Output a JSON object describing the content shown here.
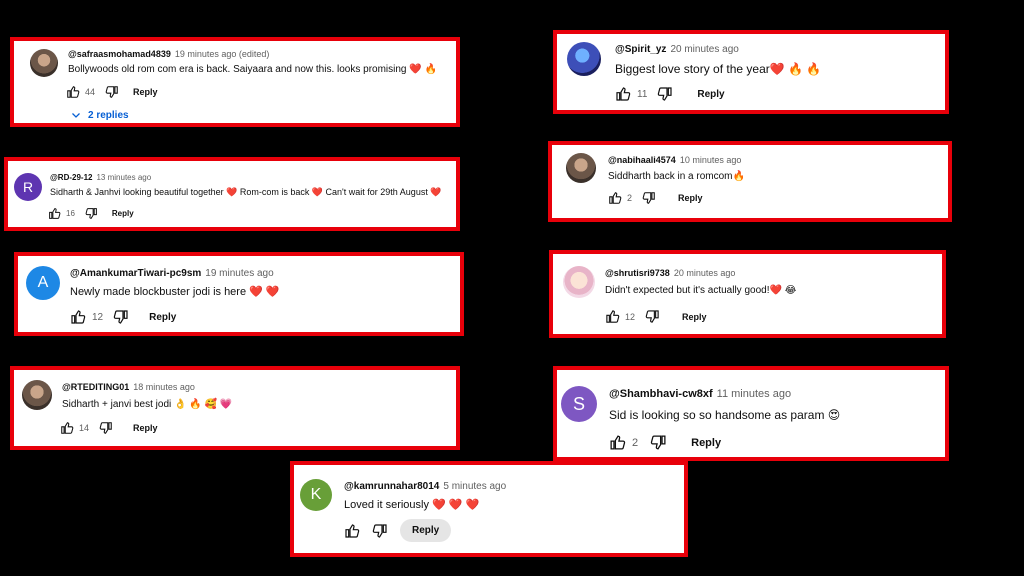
{
  "comments": [
    {
      "handle": "@safraasmohamad4839",
      "time": "19 minutes ago (edited)",
      "text": "Bollywoods old rom com era is back. Saiyaara and now this. looks promising ❤️ 🔥",
      "likes": "44",
      "reply": "Reply",
      "replies": "2 replies"
    },
    {
      "handle": "@RD-29-12",
      "avatar_letter": "R",
      "avatar_color": "#5e35b1",
      "time": "13 minutes ago",
      "text": "Sidharth & Janhvi looking beautiful together ❤️ Rom-com is back ❤️ Can't wait for 29th August ❤️",
      "likes": "16",
      "reply": "Reply"
    },
    {
      "handle": "@AmankumarTiwari-pc9sm",
      "avatar_letter": "A",
      "avatar_color": "#1e88e5",
      "time": "19 minutes ago",
      "text": "Newly made blockbuster jodi is here ❤️ ❤️",
      "likes": "12",
      "reply": "Reply"
    },
    {
      "handle": "@RTEDITING01",
      "time": "18 minutes ago",
      "text": "Sidharth + janvi best jodi 👌 🔥 🥰 💗",
      "likes": "14",
      "reply": "Reply"
    },
    {
      "handle": "@kamrunnahar8014",
      "avatar_letter": "K",
      "avatar_color": "#689f38",
      "time": "5 minutes ago",
      "text": "Loved it seriously ❤️ ❤️ ❤️",
      "likes": "",
      "reply": "Reply"
    },
    {
      "handle": "@Spirit_yz",
      "time": "20 minutes ago",
      "text": "Biggest love story of the year❤️ 🔥 🔥",
      "likes": "11",
      "reply": "Reply"
    },
    {
      "handle": "@nabihaali4574",
      "time": "10 minutes ago",
      "text": "Siddharth back in a romcom🔥",
      "likes": "2",
      "reply": "Reply"
    },
    {
      "handle": "@shrutisri9738",
      "time": "20 minutes ago",
      "text": "Didn't expected but it's actually good!❤️ 😂",
      "likes": "12",
      "reply": "Reply"
    },
    {
      "handle": "@Shambhavi-cw8xf",
      "avatar_letter": "S",
      "avatar_color": "#7e57c2",
      "time": "11 minutes ago",
      "text": "Sid is looking so so handsome as param 😍",
      "likes": "2",
      "reply": "Reply"
    }
  ],
  "colors": {
    "frame": "#e8000a",
    "link": "#065fd4",
    "background": "#000000"
  },
  "icons": [
    "thumb-up-icon",
    "thumb-down-icon",
    "chevron-down-icon"
  ]
}
